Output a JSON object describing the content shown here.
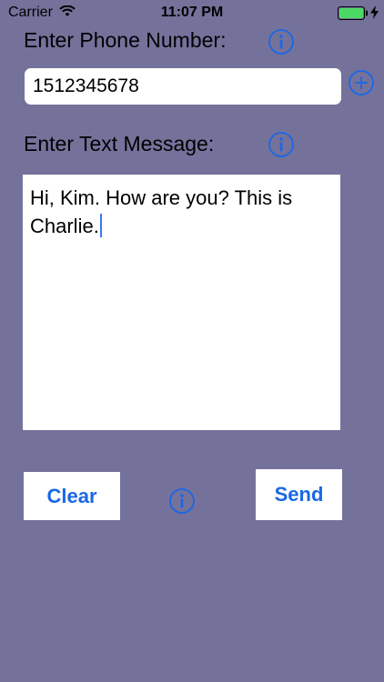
{
  "status_bar": {
    "carrier": "Carrier",
    "time": "11:07 PM",
    "icons": [
      "wifi-icon",
      "battery-icon",
      "charging-bolt-icon"
    ]
  },
  "phone": {
    "label": "Enter Phone Number:",
    "value": "1512345678",
    "info_icon": "info-icon",
    "add_icon": "plus-circle-icon"
  },
  "message": {
    "label": "Enter Text Message:",
    "value": "Hi, Kim.  How are you?  This is Charlie.",
    "info_icon": "info-icon"
  },
  "actions": {
    "clear_label": "Clear",
    "send_label": "Send",
    "info_icon": "info-icon"
  },
  "colors": {
    "background": "#74729b",
    "accent": "#1a67e6",
    "battery": "#4cd964"
  }
}
